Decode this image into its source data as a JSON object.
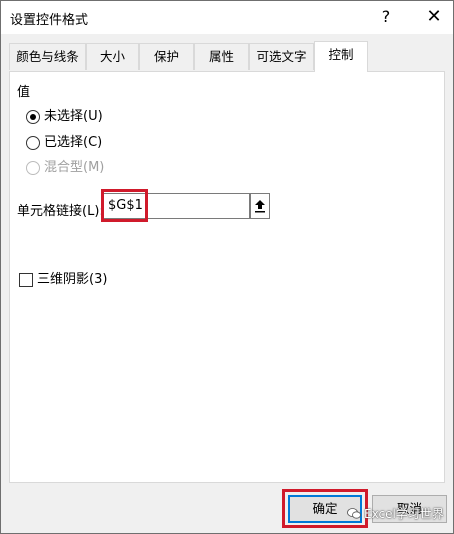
{
  "window": {
    "title": "设置控件格式",
    "help_glyph": "?",
    "close_glyph": "✕"
  },
  "tabs": [
    {
      "label": "颜色与线条",
      "active": false
    },
    {
      "label": "大小",
      "active": false
    },
    {
      "label": "保护",
      "active": false
    },
    {
      "label": "属性",
      "active": false
    },
    {
      "label": "可选文字",
      "active": false
    },
    {
      "label": "控制",
      "active": true
    }
  ],
  "value_group": {
    "label": "值",
    "options": [
      {
        "label": "未选择(U)",
        "checked": true,
        "disabled": false
      },
      {
        "label": "已选择(C)",
        "checked": false,
        "disabled": false
      },
      {
        "label": "混合型(M)",
        "checked": false,
        "disabled": true
      }
    ]
  },
  "cell_link": {
    "label": "单元格链接(L):",
    "value": "$G$1",
    "collapse_icon": "collapse-dialog-icon"
  },
  "shading": {
    "label": "三维阴影(3)",
    "checked": false
  },
  "buttons": {
    "ok": "确定",
    "cancel": "取消"
  },
  "watermark": {
    "text": "Excel学习世界",
    "icon": "wechat-icon"
  },
  "colors": {
    "highlight_box": "#d01a2b",
    "default_button_border": "#0078d7"
  }
}
